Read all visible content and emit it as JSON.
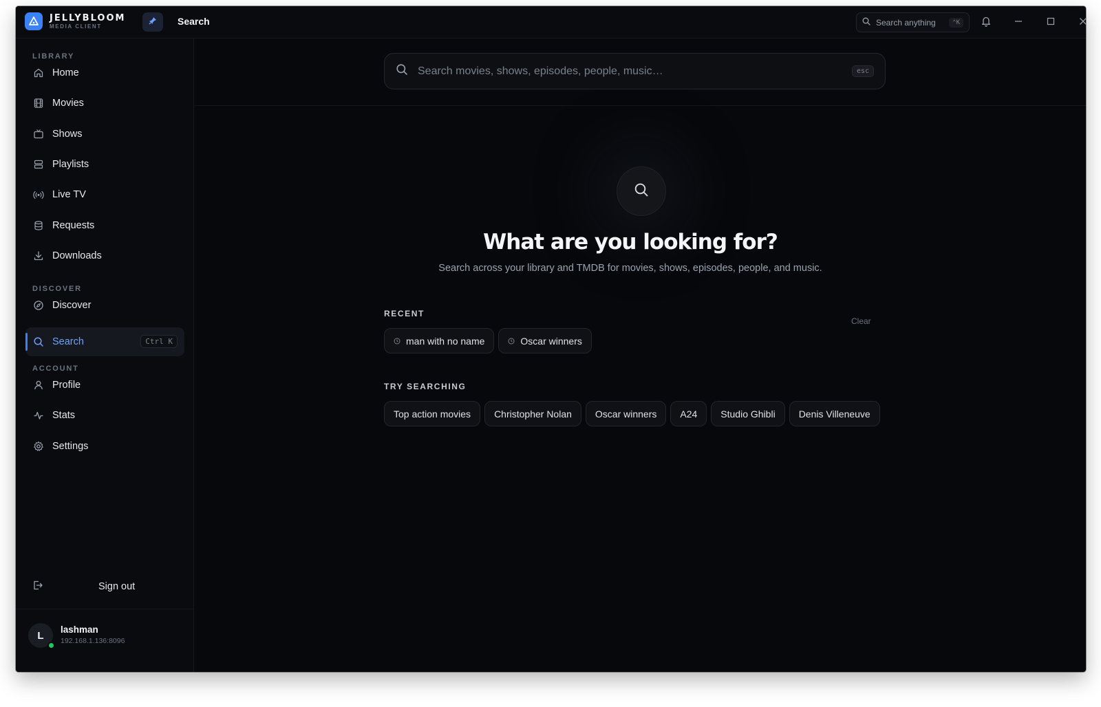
{
  "app": {
    "name": "JELLYBLOOM",
    "subtitle": "MEDIA CLIENT",
    "page_title": "Search",
    "accent": "#3b82f6"
  },
  "titlebar": {
    "search_placeholder": "Search anything",
    "search_shortcut": "⌃K",
    "icons": [
      "pin-icon",
      "search-icon",
      "bell-icon",
      "minimize-icon",
      "maximize-icon",
      "close-icon"
    ]
  },
  "sidebar": {
    "sections": {
      "library": "LIBRARY",
      "discover": "DISCOVER",
      "account": "ACCOUNT"
    },
    "items": [
      {
        "label": "Home",
        "icon": "home-icon"
      },
      {
        "label": "Movies",
        "icon": "film-icon"
      },
      {
        "label": "Shows",
        "icon": "tv-icon"
      },
      {
        "label": "Playlists",
        "icon": "playlist-icon"
      },
      {
        "label": "Live TV",
        "icon": "broadcast-icon"
      },
      {
        "label": "Requests",
        "icon": "database-icon"
      },
      {
        "label": "Downloads",
        "icon": "download-icon"
      },
      {
        "label": "Discover",
        "icon": "compass-icon"
      },
      {
        "label": "Search",
        "icon": "search-icon",
        "active": true,
        "shortcut": "Ctrl K"
      },
      {
        "label": "Profile",
        "icon": "user-icon"
      },
      {
        "label": "Stats",
        "icon": "activity-icon"
      },
      {
        "label": "Settings",
        "icon": "gear-icon"
      }
    ],
    "signout": "Sign out",
    "user": {
      "initial": "L",
      "name": "lashman",
      "host": "192.168.1.136:8096",
      "status_color": "#22c55e"
    }
  },
  "main": {
    "search": {
      "placeholder": "Search movies, shows, episodes, people, music…",
      "value": "",
      "esc_hint": "esc"
    },
    "hero": {
      "title": "What are you looking for?",
      "subtitle": "Search across your library and TMDB for movies, shows, episodes, people, and music."
    },
    "recent": {
      "label": "RECENT",
      "clear": "Clear",
      "items": [
        "man with no name",
        "Oscar winners"
      ]
    },
    "suggestions": {
      "label": "TRY SEARCHING",
      "items": [
        "Top action movies",
        "Christopher Nolan",
        "Oscar winners",
        "A24",
        "Studio Ghibli",
        "Denis Villeneuve"
      ]
    }
  }
}
